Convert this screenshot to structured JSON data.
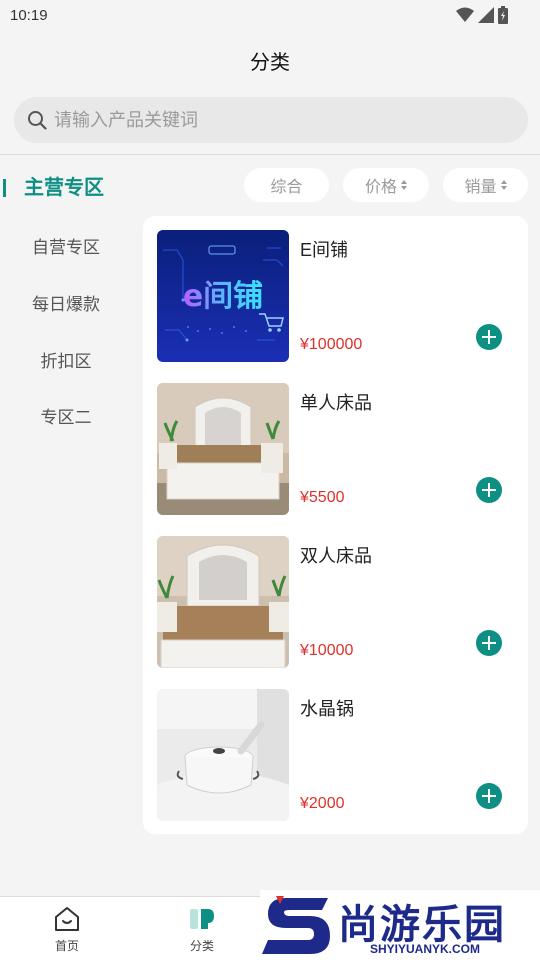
{
  "status": {
    "time": "10:19"
  },
  "header": {
    "title": "分类"
  },
  "search": {
    "placeholder": "请输入产品关键词"
  },
  "sidebar": {
    "items": [
      {
        "label": "主营专区",
        "active": true
      },
      {
        "label": "自营专区",
        "active": false
      },
      {
        "label": "每日爆款",
        "active": false
      },
      {
        "label": "折扣区",
        "active": false
      },
      {
        "label": "专区二",
        "active": false
      }
    ]
  },
  "sort": {
    "general": "综合",
    "price": "价格",
    "sales": "销量"
  },
  "products": [
    {
      "name": "E间铺",
      "price": "¥100000",
      "image": "e-store-banner"
    },
    {
      "name": "单人床品",
      "price": "¥5500",
      "image": "single-bed-photo"
    },
    {
      "name": "双人床品",
      "price": "¥10000",
      "image": "double-bed-photo"
    },
    {
      "name": "水晶锅",
      "price": "¥2000",
      "image": "crystal-pot-photo"
    }
  ],
  "logo_text": "e间铺",
  "tabs": [
    {
      "label": "首页",
      "icon": "home-icon"
    },
    {
      "label": "分类",
      "icon": "category-icon"
    }
  ],
  "watermark": {
    "cn": "尚游乐园",
    "en": "SHYIYUANYK.COM"
  },
  "colors": {
    "accent": "#0e8f84",
    "price": "#e0302a",
    "background": "#f4f4f4"
  }
}
